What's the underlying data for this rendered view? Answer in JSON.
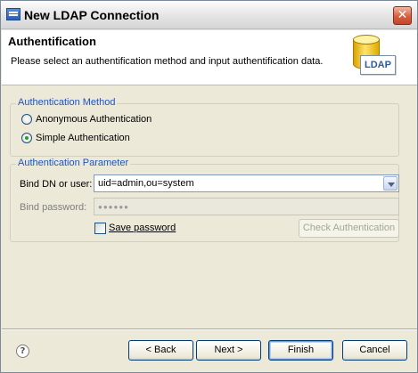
{
  "window": {
    "title": "New LDAP Connection",
    "close_glyph": "✕"
  },
  "banner": {
    "title": "Authentification",
    "description": "Please select an authentification method and input authentification data.",
    "logo_text": "LDAP",
    "logo_icon": "ldap-database-icon"
  },
  "auth_method": {
    "legend": "Authentication Method",
    "options": [
      {
        "label": "Anonymous Authentication",
        "selected": false
      },
      {
        "label": "Simple Authentication",
        "selected": true
      }
    ]
  },
  "auth_param": {
    "legend": "Authentication Parameter",
    "bind_dn_label": "Bind DN or user:",
    "bind_dn_value": "uid=admin,ou=system",
    "bind_password_label": "Bind password:",
    "bind_password_value": "●●●●●●",
    "save_password_label": "Save password",
    "save_password_checked": false,
    "check_button": "Check Authentication"
  },
  "buttons": {
    "back": "< Back",
    "next": "Next >",
    "finish": "Finish",
    "cancel": "Cancel"
  },
  "help": {
    "glyph": "?",
    "icon": "help-icon"
  },
  "colors": {
    "legend": "#1a54c8",
    "window_bg": "#ece9d8",
    "accent_button_border": "#003c74"
  }
}
